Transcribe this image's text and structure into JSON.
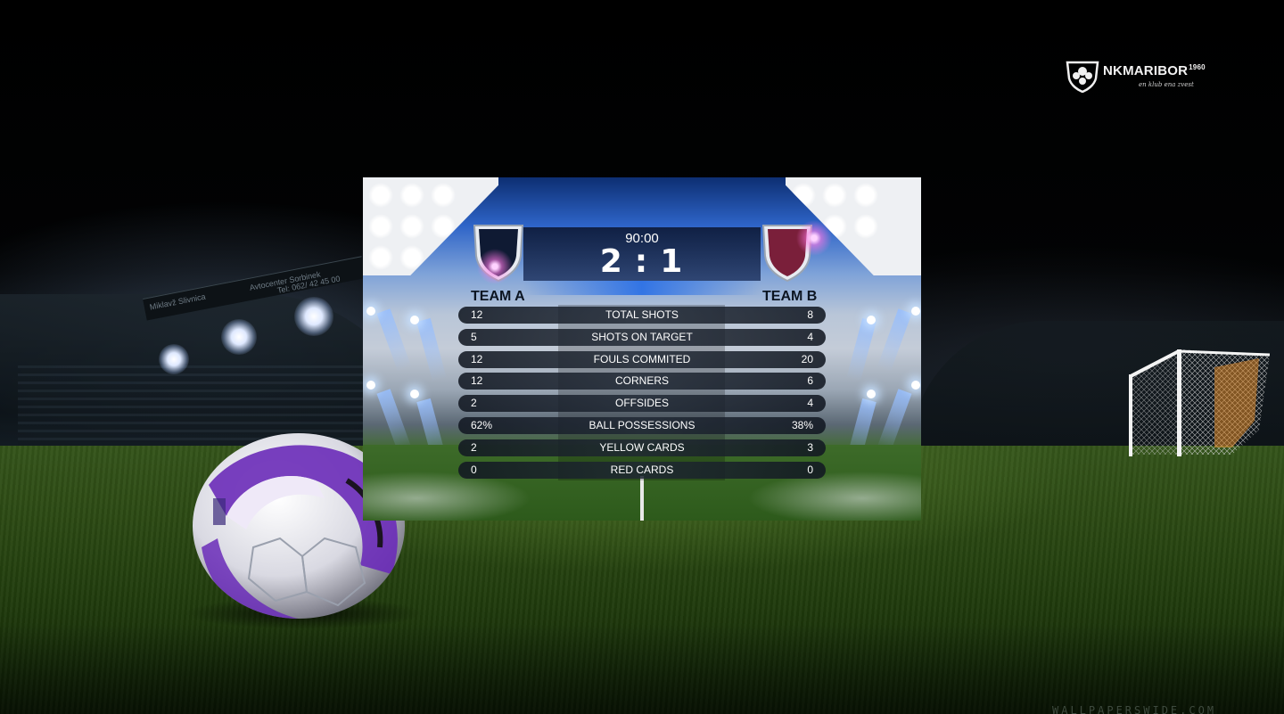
{
  "brand": {
    "name": "NKMARIBOR",
    "year": "1960",
    "motto": "en klub ena zvest"
  },
  "stadium_ad": {
    "left_text": "Miklavž Slivnica",
    "right_text": "Avtocenter Sorbinek",
    "phone": "Tel: 062/ 42 45 00"
  },
  "watermark": "WALLPAPERSWIDE.COM",
  "match": {
    "time": "90:00",
    "home_score": "2",
    "separator": ":",
    "away_score": "1",
    "home_team": "TEAM A",
    "away_team": "TEAM B",
    "home_crest": {
      "icon": "team-a-shield-icon",
      "color": "#0f1a33"
    },
    "away_crest": {
      "icon": "team-b-shield-icon",
      "color": "#7a1f3a"
    }
  },
  "stats": [
    {
      "label": "TOTAL SHOTS",
      "home": "12",
      "away": "8"
    },
    {
      "label": "SHOTS ON TARGET",
      "home": "5",
      "away": "4"
    },
    {
      "label": "FOULS COMMITED",
      "home": "12",
      "away": "20"
    },
    {
      "label": "CORNERS",
      "home": "12",
      "away": "6"
    },
    {
      "label": "OFFSIDES",
      "home": "2",
      "away": "4"
    },
    {
      "label": "BALL POSSESSIONS",
      "home": "62%",
      "away": "38%"
    },
    {
      "label": "YELLOW CARDS",
      "home": "2",
      "away": "3"
    },
    {
      "label": "RED CARDS",
      "home": "0",
      "away": "0"
    }
  ],
  "colors": {
    "accent_blue": "#2e64c8",
    "pitch_green": "#2c4a14",
    "ball_purple": "#6a2bb8"
  }
}
